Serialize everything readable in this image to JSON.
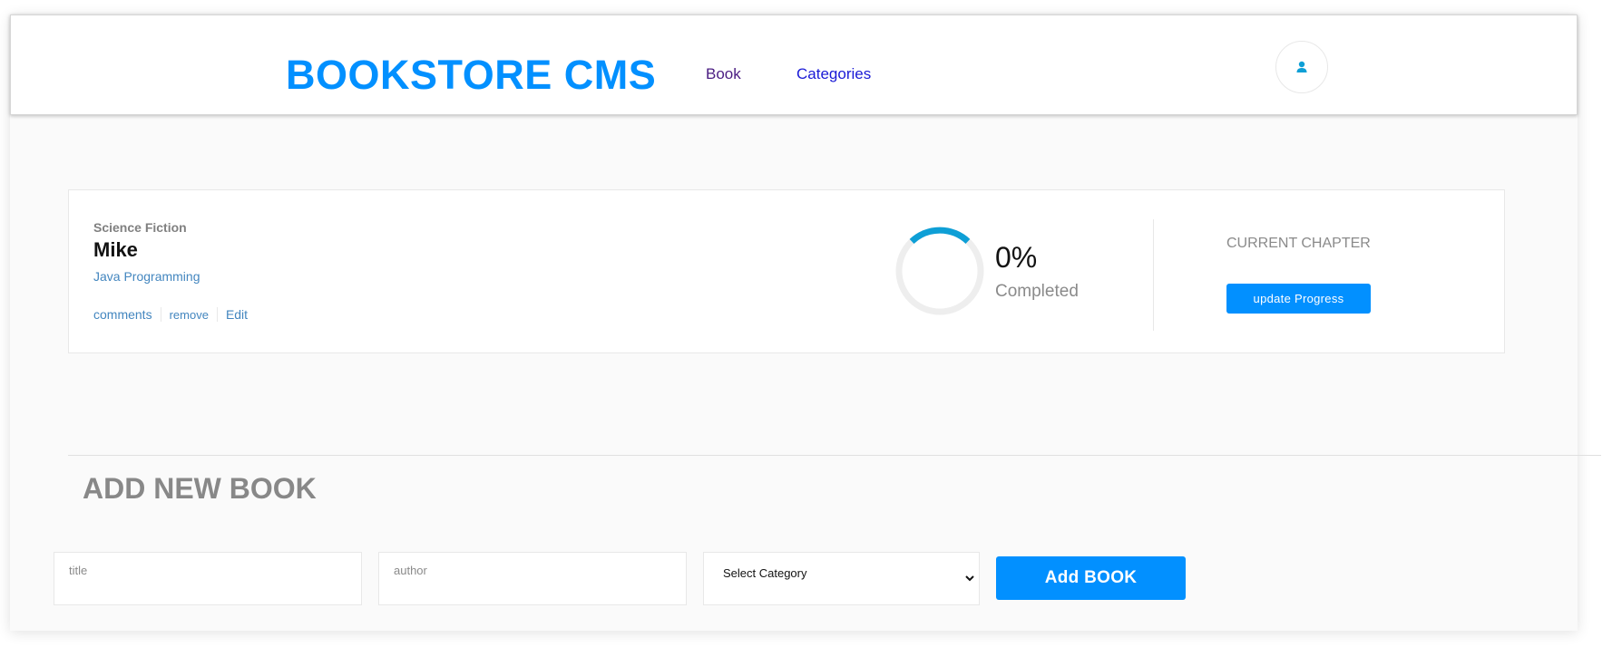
{
  "header": {
    "brand": "BOOKSTORE CMS",
    "nav": [
      {
        "label": "Book"
      },
      {
        "label": "Categories"
      }
    ]
  },
  "books": [
    {
      "genre": "Science Fiction",
      "title": "Mike",
      "author": "Java Programming",
      "actions": {
        "comments": "comments",
        "remove": "remove",
        "edit": "Edit"
      },
      "progress_percent": 0,
      "percent_label": "0%",
      "completed_label": "Completed",
      "chapter_label": "CURRENT CHAPTER",
      "update_button": "update Progress"
    }
  ],
  "add_form": {
    "heading": "ADD NEW BOOK",
    "title_placeholder": "title",
    "author_placeholder": "author",
    "category_selected": "Select Category",
    "submit_label": "Add BOOK"
  },
  "colors": {
    "accent": "#0290ff",
    "ring_track": "#eeeeee",
    "ring_fill": "#0e9fd6",
    "link": "#4386bf"
  },
  "icons": {
    "avatar": "user-icon",
    "select": "chevron-down-icon"
  }
}
